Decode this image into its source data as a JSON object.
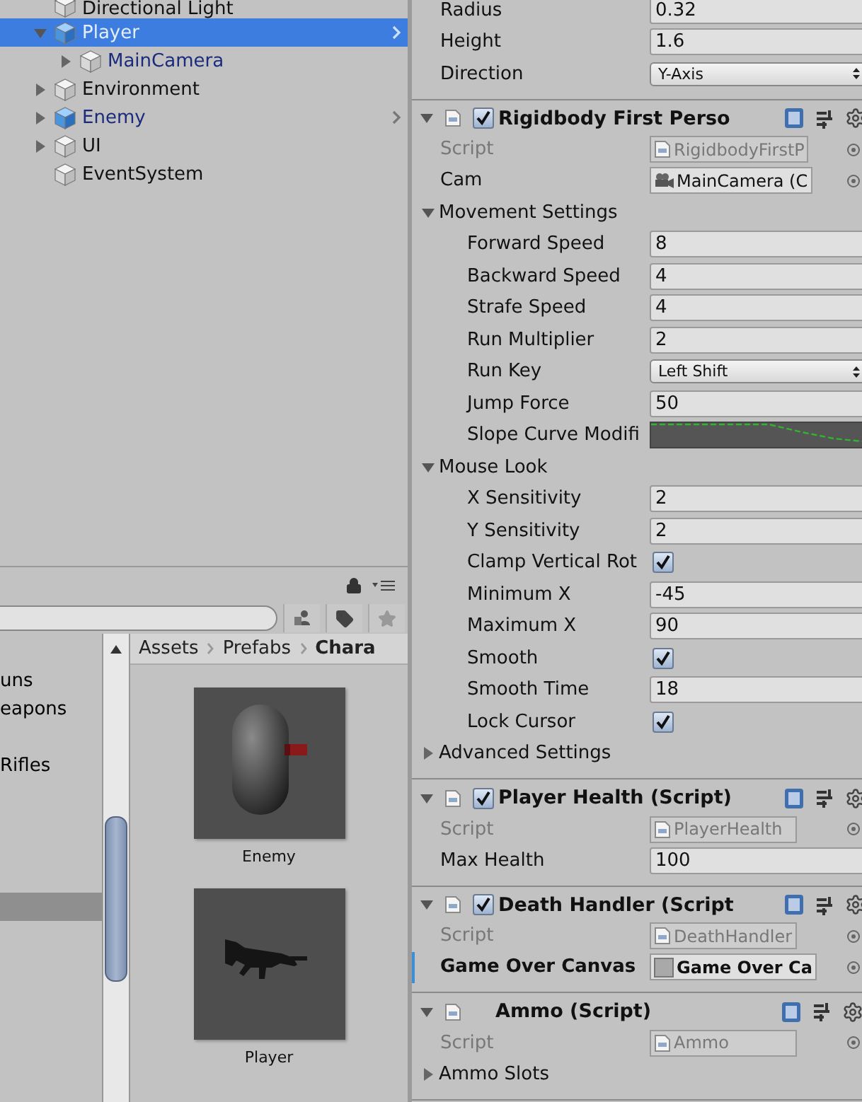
{
  "hierarchy": [
    {
      "name": "Directional Light",
      "kind": "object",
      "selected": false
    },
    {
      "name": "Player",
      "kind": "prefab",
      "selected": true,
      "expanded": true,
      "children": [
        {
          "name": "MainCamera",
          "kind": "prefab_child",
          "selected": false,
          "expanded": false
        }
      ]
    },
    {
      "name": "Environment",
      "kind": "object",
      "selected": false,
      "expanded": false
    },
    {
      "name": "Enemy",
      "kind": "prefab",
      "selected": false,
      "expanded": false
    },
    {
      "name": "UI",
      "kind": "object",
      "selected": false,
      "expanded": false
    },
    {
      "name": "EventSystem",
      "kind": "object",
      "selected": false
    }
  ],
  "project": {
    "folders": [
      {
        "label": "uns",
        "selected": false
      },
      {
        "label": "eapons",
        "selected": false
      },
      {
        "selected": false
      },
      {
        "label": "Rifles",
        "selected": false
      },
      {
        "selected": false
      },
      {
        "selected": false
      },
      {
        "selected": false
      },
      {
        "selected": false
      },
      {
        "selected": true
      }
    ],
    "breadcrumb": [
      "Assets",
      "Prefabs",
      "Chara"
    ],
    "assets": [
      {
        "name": "Enemy",
        "kind": "picture"
      },
      {
        "name": "Player",
        "kind": "picture"
      }
    ]
  },
  "inspector": {
    "components": [
      {
        "rows": [
          {
            "kind": "field",
            "label": "Radius",
            "value": "0.32"
          },
          {
            "kind": "field",
            "label": "Height",
            "value": "1.6"
          },
          {
            "kind": "dropdown",
            "label": "Direction",
            "value": "Y-Axis"
          }
        ]
      },
      {
        "header": {
          "title": "Rigidbody First Perso",
          "enabled": true
        },
        "rows": [
          {
            "kind": "script",
            "label": "Script",
            "value": "RigidbodyFirstP"
          },
          {
            "kind": "camera_ref",
            "label": "Cam",
            "value": "MainCamera (C"
          },
          {
            "kind": "foldout",
            "label": "Movement Settings",
            "expanded": true
          },
          {
            "kind": "field",
            "label": "Forward Speed",
            "value": "8",
            "nested": true
          },
          {
            "kind": "field",
            "label": "Backward Speed",
            "value": "4",
            "nested": true
          },
          {
            "kind": "field",
            "label": "Strafe Speed",
            "value": "4",
            "nested": true
          },
          {
            "kind": "field",
            "label": "Run Multiplier",
            "value": "2",
            "nested": true
          },
          {
            "kind": "dropdown",
            "label": "Run Key",
            "value": "Left Shift",
            "nested": true
          },
          {
            "kind": "field",
            "label": "Jump Force",
            "value": "50",
            "nested": true
          },
          {
            "kind": "curve",
            "label": "Slope Curve Modifi",
            "nested": true
          },
          {
            "kind": "foldout",
            "label": "Mouse Look",
            "expanded": true
          },
          {
            "kind": "field",
            "label": "X Sensitivity",
            "value": "2",
            "nested": true
          },
          {
            "kind": "field",
            "label": "Y Sensitivity",
            "value": "2",
            "nested": true
          },
          {
            "kind": "checkbox",
            "label": "Clamp Vertical Rot",
            "checked": true,
            "nested": true
          },
          {
            "kind": "field",
            "label": "Minimum X",
            "value": "-45",
            "nested": true
          },
          {
            "kind": "field",
            "label": "Maximum X",
            "value": "90",
            "nested": true
          },
          {
            "kind": "checkbox",
            "label": "Smooth",
            "checked": true,
            "nested": true
          },
          {
            "kind": "field",
            "label": "Smooth Time",
            "value": "18",
            "nested": true
          },
          {
            "kind": "checkbox",
            "label": "Lock Cursor",
            "checked": true,
            "nested": true
          },
          {
            "kind": "foldout",
            "label": "Advanced Settings",
            "expanded": false
          }
        ]
      },
      {
        "header": {
          "title": "Player Health (Script)",
          "enabled": true
        },
        "rows": [
          {
            "kind": "script",
            "label": "Script",
            "value": "PlayerHealth"
          },
          {
            "kind": "field",
            "label": "Max Health",
            "value": "100"
          }
        ]
      },
      {
        "header": {
          "title": "Death Handler (Script",
          "enabled": true
        },
        "rows": [
          {
            "kind": "script",
            "label": "Script",
            "value": "DeathHandler"
          },
          {
            "kind": "object_ref",
            "label": "Game Over Canvas",
            "value": "Game Over Ca",
            "modified": true
          }
        ]
      },
      {
        "header": {
          "title": "Ammo (Script)"
        },
        "rows": [
          {
            "kind": "script",
            "label": "Script",
            "value": "Ammo"
          },
          {
            "kind": "foldout",
            "label": "Ammo Slots",
            "expanded": false
          }
        ]
      }
    ]
  }
}
